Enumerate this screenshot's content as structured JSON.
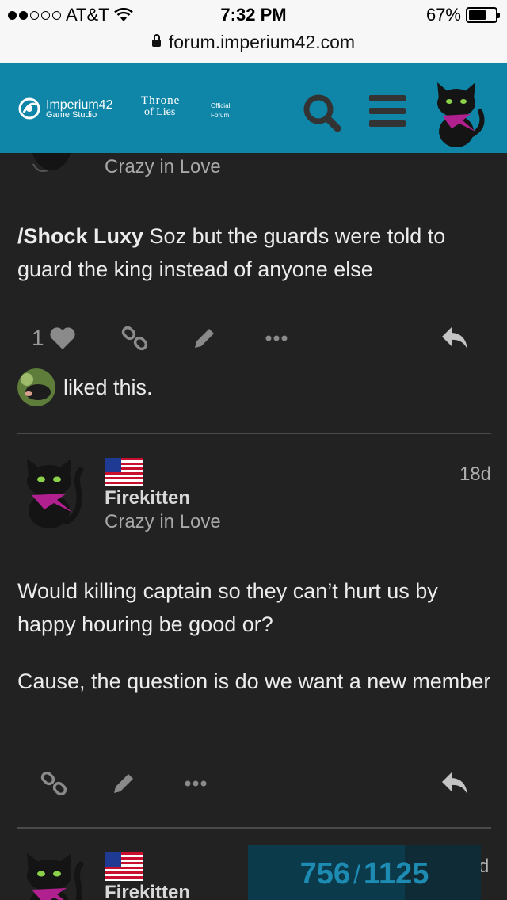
{
  "status_bar": {
    "carrier": "AT&T",
    "time": "7:32 PM",
    "battery_percent": "67%",
    "battery_level": 0.67,
    "signal_bars_filled": 2,
    "signal_bars_total": 5
  },
  "url_bar": {
    "url": "forum.imperium42.com"
  },
  "header": {
    "brand_name": "Imperium42",
    "brand_sub": "Game Studio",
    "game_title_top": "Throne",
    "game_title_bottom": "of Lies",
    "official_line1": "Official",
    "official_line2": "Forum",
    "accent_color": "#0f86a8"
  },
  "post_top": {
    "user_title": "Crazy in Love",
    "body_mention": "/Shock Luxy",
    "body_text": " Soz but the guards were told to guard the king instead of anyone else",
    "like_count": "1",
    "liked_text": "liked this."
  },
  "post_2": {
    "username": "Firekitten",
    "user_title": "Crazy in Love",
    "date": "18d",
    "paragraph_1": "Would killing captain so they can’t hurt us by happy houring be good or?",
    "paragraph_2": "Cause, the question is do we want a new member"
  },
  "post_3": {
    "username": "Firekitten",
    "date_partial": "d"
  },
  "timeline": {
    "current": "756",
    "separator": "/",
    "total": "1125"
  }
}
